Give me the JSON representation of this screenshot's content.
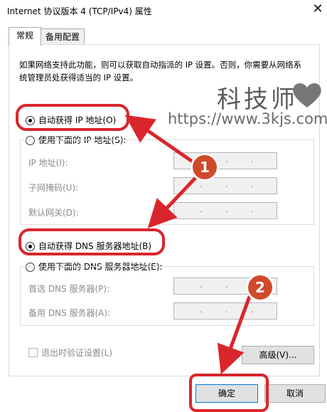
{
  "window": {
    "title": "Internet 协议版本 4 (TCP/IPv4) 属性",
    "close_symbol": "✕"
  },
  "tabs": [
    {
      "label": "常规"
    },
    {
      "label": "备用配置"
    }
  ],
  "description": "如果网络支持此功能，则可以获取自动指派的 IP 设置。否则，你需要从网络系统管理员处获得适当的 IP 设置。",
  "watermark": {
    "brand": "科技师",
    "url": "https://www.3kjs.com"
  },
  "ip": {
    "auto_label": "自动获得 IP 地址(O)",
    "manual_label": "使用下面的 IP 地址(S):",
    "fields": [
      {
        "label": "IP 地址(I):"
      },
      {
        "label": "子网掩码(U):"
      },
      {
        "label": "默认网关(D):"
      }
    ]
  },
  "dns": {
    "auto_label": "自动获得 DNS 服务器地址(B)",
    "manual_label": "使用下面的 DNS 服务器地址(E):",
    "fields": [
      {
        "label": "首选 DNS 服务器(P):"
      },
      {
        "label": "备用 DNS 服务器(A):"
      }
    ]
  },
  "validate_label": "退出时验证设置(L)",
  "advanced_label": "高级(V)...",
  "ok_label": "确定",
  "cancel_label": "取消",
  "ip_separator": ".",
  "annotations": {
    "badge1": "1",
    "badge2": "2",
    "color": "#d9262c"
  }
}
